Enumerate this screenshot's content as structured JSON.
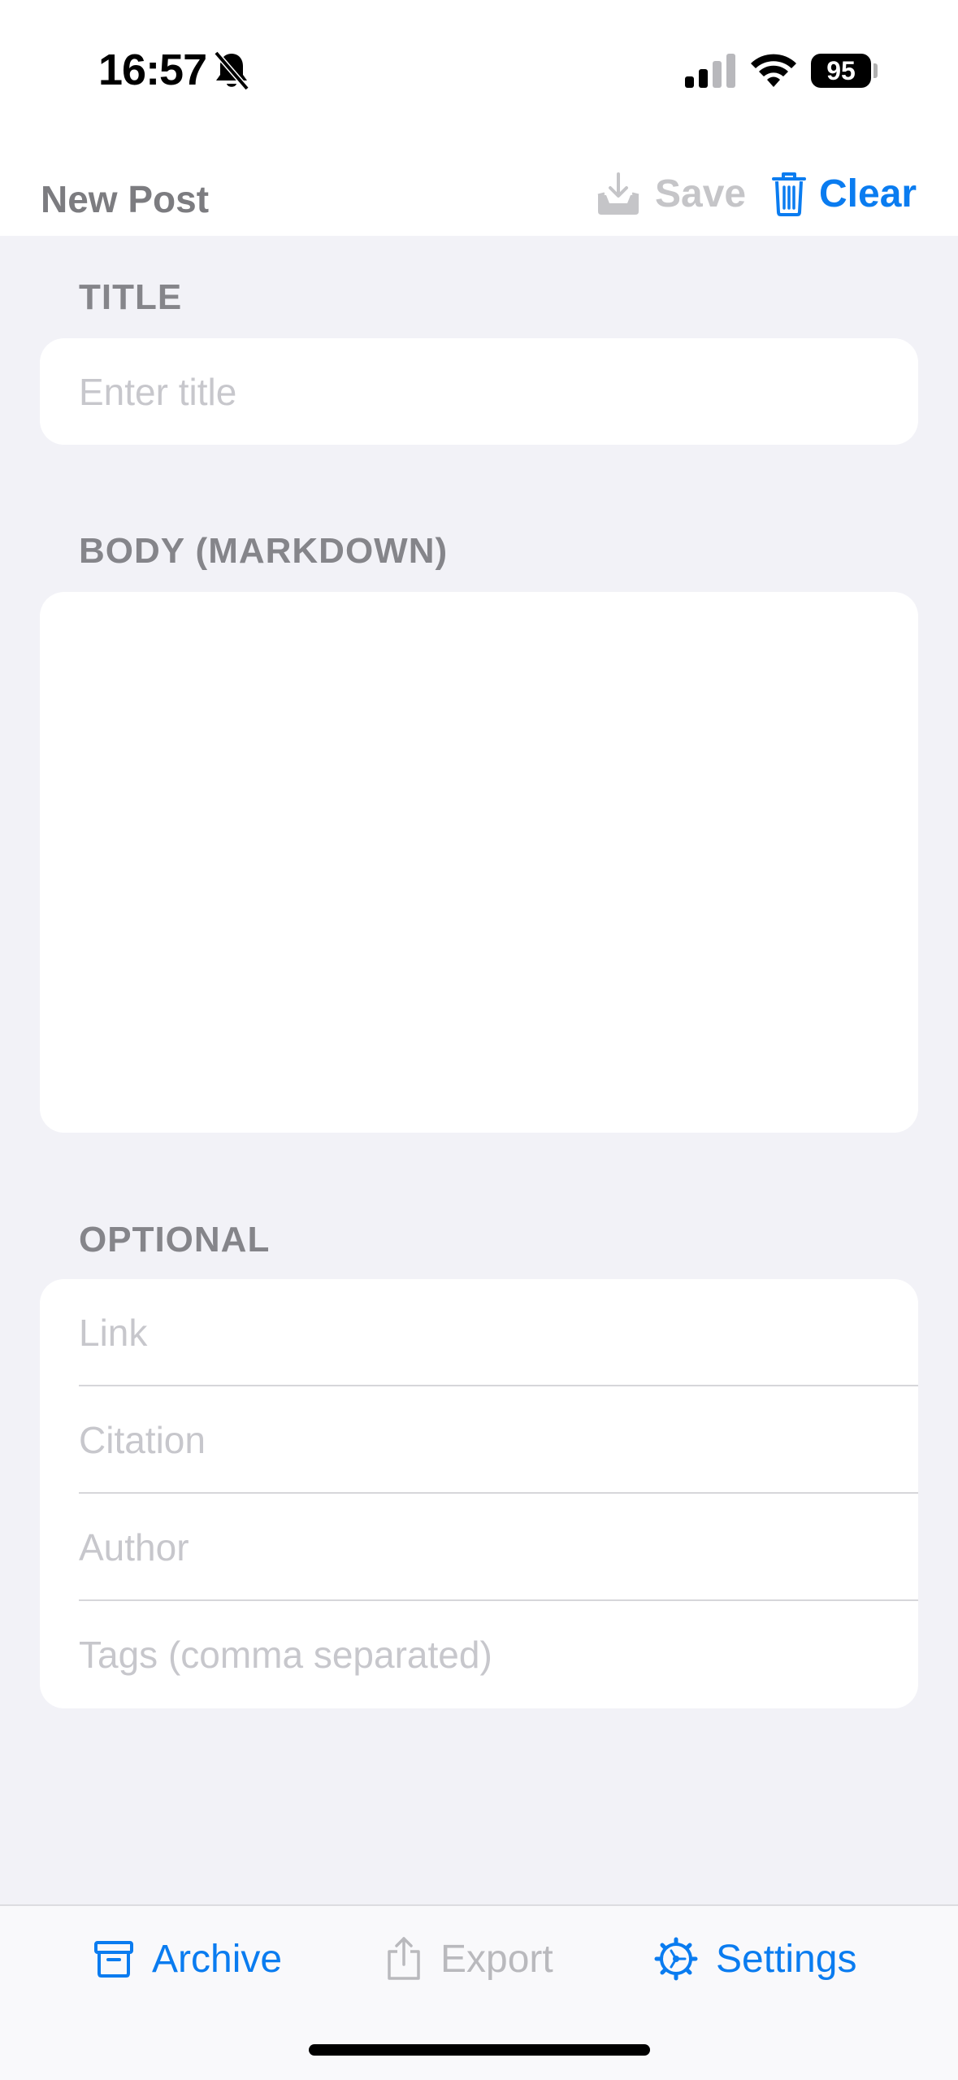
{
  "status_bar": {
    "time": "16:57",
    "battery": "95"
  },
  "nav": {
    "title": "New Post",
    "save_label": "Save",
    "clear_label": "Clear"
  },
  "sections": {
    "title": {
      "label": "TITLE",
      "placeholder": "Enter title"
    },
    "body": {
      "label": "BODY (MARKDOWN)"
    },
    "optional": {
      "label": "OPTIONAL",
      "fields": [
        {
          "placeholder": "Link"
        },
        {
          "placeholder": "Citation"
        },
        {
          "placeholder": "Author"
        },
        {
          "placeholder": "Tags (comma separated)"
        }
      ]
    }
  },
  "tabbar": {
    "archive_label": "Archive",
    "export_label": "Export",
    "settings_label": "Settings"
  },
  "colors": {
    "accent": "#0a7cf0",
    "background": "#f2f2f7",
    "placeholder": "#c7c7cc",
    "section_label": "#85858a"
  },
  "icons": {
    "bell": "bell-slash-icon",
    "signal": "cellular-signal-icon",
    "wifi": "wifi-icon",
    "save": "tray-download-icon",
    "clear": "trash-icon",
    "archive": "archive-box-icon",
    "export": "share-icon",
    "settings": "gear-icon"
  }
}
